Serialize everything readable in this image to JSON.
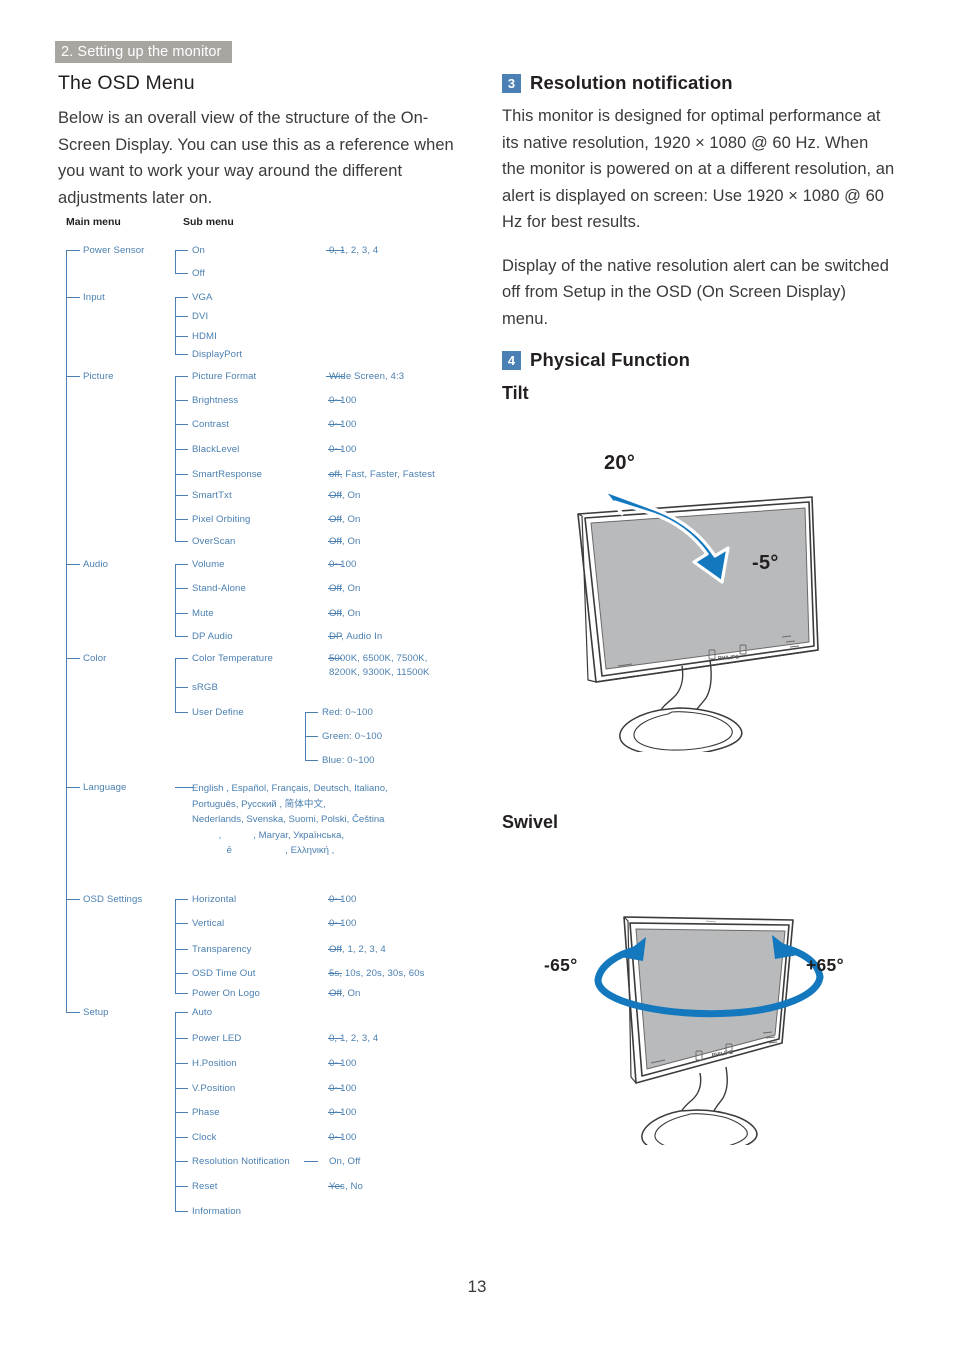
{
  "header": {
    "chapter": "2. Setting up the monitor"
  },
  "left": {
    "section_title": "The OSD Menu",
    "intro": "Below is an overall view of the structure of the On-Screen Display. You can use this as a reference when you want to work your way around the different adjustments later on.",
    "tree_headers": {
      "main": "Main menu",
      "sub": "Sub menu"
    },
    "tree": [
      {
        "main": "Power Sensor",
        "subs": [
          {
            "label": "On",
            "value": "0, 1, 2, 3, 4"
          },
          {
            "label": "Off",
            "value": ""
          }
        ]
      },
      {
        "main": "Input",
        "subs": [
          {
            "label": "VGA",
            "value": ""
          },
          {
            "label": "DVI",
            "value": ""
          },
          {
            "label": "HDMI",
            "value": ""
          },
          {
            "label": "DisplayPort",
            "value": ""
          }
        ]
      },
      {
        "main": "Picture",
        "subs": [
          {
            "label": "Picture Format",
            "value": "Wide Screen, 4:3"
          },
          {
            "label": "Brightness",
            "value": "0~100"
          },
          {
            "label": "Contrast",
            "value": "0~100"
          },
          {
            "label": "BlackLevel",
            "value": "0~100"
          },
          {
            "label": "SmartResponse",
            "value": "off, Fast, Faster, Fastest"
          },
          {
            "label": "SmartTxt",
            "value": "Off, On"
          },
          {
            "label": "Pixel Orbiting",
            "value": "Off, On"
          },
          {
            "label": "OverScan",
            "value": "Off, On"
          }
        ]
      },
      {
        "main": "Audio",
        "subs": [
          {
            "label": "Volume",
            "value": "0~100"
          },
          {
            "label": "Stand-Alone",
            "value": "Off, On"
          },
          {
            "label": "Mute",
            "value": "Off, On"
          },
          {
            "label": "DP Audio",
            "value": "DP, Audio In"
          }
        ]
      },
      {
        "main": "Color",
        "subs": [
          {
            "label": "Color Temperature",
            "value": "5000K, 6500K, 7500K,\n8200K, 9300K, 11500K"
          },
          {
            "label": "sRGB",
            "value": ""
          },
          {
            "label": "User Define",
            "value": ""
          }
        ]
      },
      {
        "main": "Language",
        "subs": []
      },
      {
        "main": "OSD Settings",
        "subs": [
          {
            "label": "Horizontal",
            "value": "0~100"
          },
          {
            "label": "Vertical",
            "value": "0~100"
          },
          {
            "label": "Transparency",
            "value": "Off, 1, 2, 3, 4"
          },
          {
            "label": "OSD Time Out",
            "value": "5s, 10s, 20s, 30s, 60s"
          },
          {
            "label": "Power On Logo",
            "value": "Off, On"
          }
        ]
      },
      {
        "main": "Setup",
        "subs": [
          {
            "label": "Auto",
            "value": ""
          },
          {
            "label": "Power LED",
            "value": "0, 1, 2, 3, 4"
          },
          {
            "label": "H.Position",
            "value": "0~100"
          },
          {
            "label": "V.Position",
            "value": "0~100"
          },
          {
            "label": "Phase",
            "value": "0~100"
          },
          {
            "label": "Clock",
            "value": "0~100"
          },
          {
            "label": "Resolution Notification",
            "value": "On, Off"
          },
          {
            "label": "Reset",
            "value": "Yes, No"
          },
          {
            "label": "Information",
            "value": ""
          }
        ]
      }
    ],
    "user_define": [
      {
        "label": "Red: 0~100"
      },
      {
        "label": "Green: 0~100"
      },
      {
        "label": "Blue: 0~100"
      }
    ],
    "language_lines": [
      "English , Español, Français, Deutsch, Italiano,",
      "Português, Русский , 简体中文,",
      "Nederlands, Svenska, Suomi, Polski, Čeština",
      "          ,            , Maryar, Українська,",
      "             ē                    , Ελληνική ,"
    ],
    "color_temp_line2": "8200K, 9300K, 11500K"
  },
  "right": {
    "block3": {
      "number": "3",
      "title": "Resolution notification",
      "para1": "This monitor is designed for optimal performance at its native resolution, 1920 × 1080 @ 60 Hz. When the monitor is powered on at a different resolution, an alert is displayed on screen: Use 1920 × 1080 @ 60 Hz for best results.",
      "para2": "Display of the native resolution alert can be switched off from Setup in the OSD (On Screen Display) menu."
    },
    "block4": {
      "number": "4",
      "title": "Physical Function",
      "tilt_heading": "Tilt",
      "tilt_up": "20°",
      "tilt_down": "-5°",
      "swivel_heading": "Swivel",
      "swivel_left": "-65°",
      "swivel_right": "+65°"
    }
  },
  "footer": {
    "page_number": "13"
  },
  "colors": {
    "chapter_bar": "#a9a5a1",
    "badge_blue": "#4a80b4",
    "tree_blue": "#4a7fb0",
    "arrow_blue": "#1378be",
    "screen_gray": "#b9babc",
    "body_text": "#3a3a3a"
  }
}
